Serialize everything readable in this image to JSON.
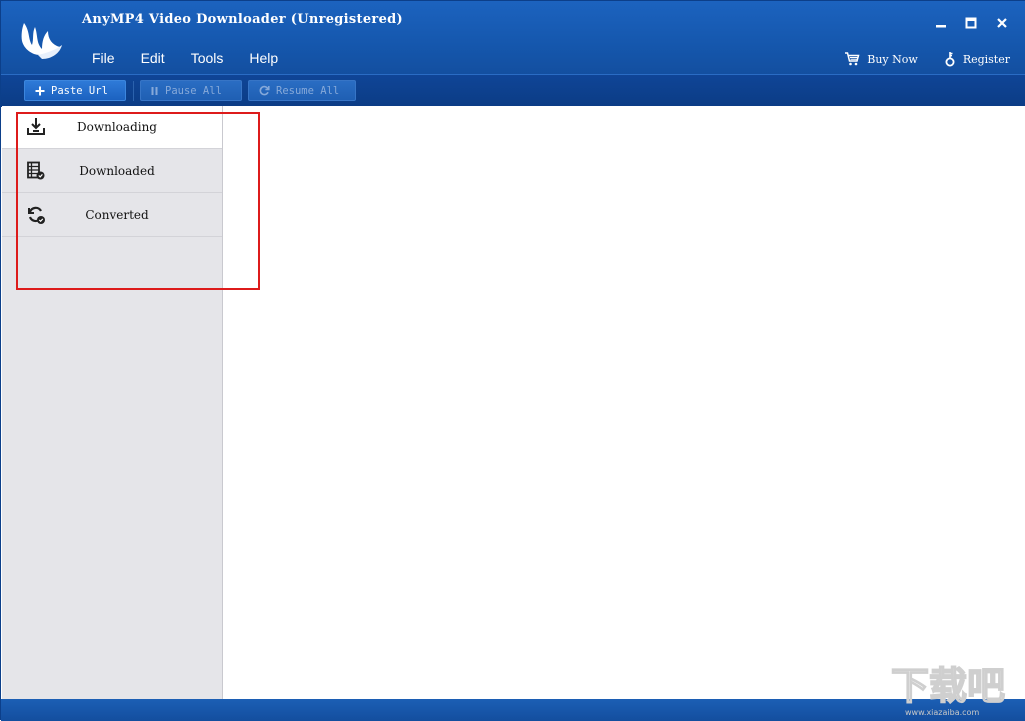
{
  "window": {
    "title": "AnyMP4 Video Downloader (Unregistered)"
  },
  "menu": [
    "File",
    "Edit",
    "Tools",
    "Help"
  ],
  "actions": {
    "buy_now": "Buy Now",
    "register": "Register"
  },
  "toolbar": {
    "paste_url": "Paste Url",
    "pause_all": "Pause All",
    "resume_all": "Resume All"
  },
  "sidebar": {
    "items": [
      {
        "label": "Downloading",
        "icon": "download-icon",
        "active": true
      },
      {
        "label": "Downloaded",
        "icon": "film-icon",
        "active": false
      },
      {
        "label": "Converted",
        "icon": "convert-icon",
        "active": false
      }
    ]
  },
  "watermark": {
    "text": "下载吧",
    "url": "www.xiazaiba.com"
  },
  "colors": {
    "titlebar": "#1557ad",
    "toolbar": "#0b3c85",
    "sidebar": "#e5e5e9",
    "highlight": "#dd1b1b"
  }
}
